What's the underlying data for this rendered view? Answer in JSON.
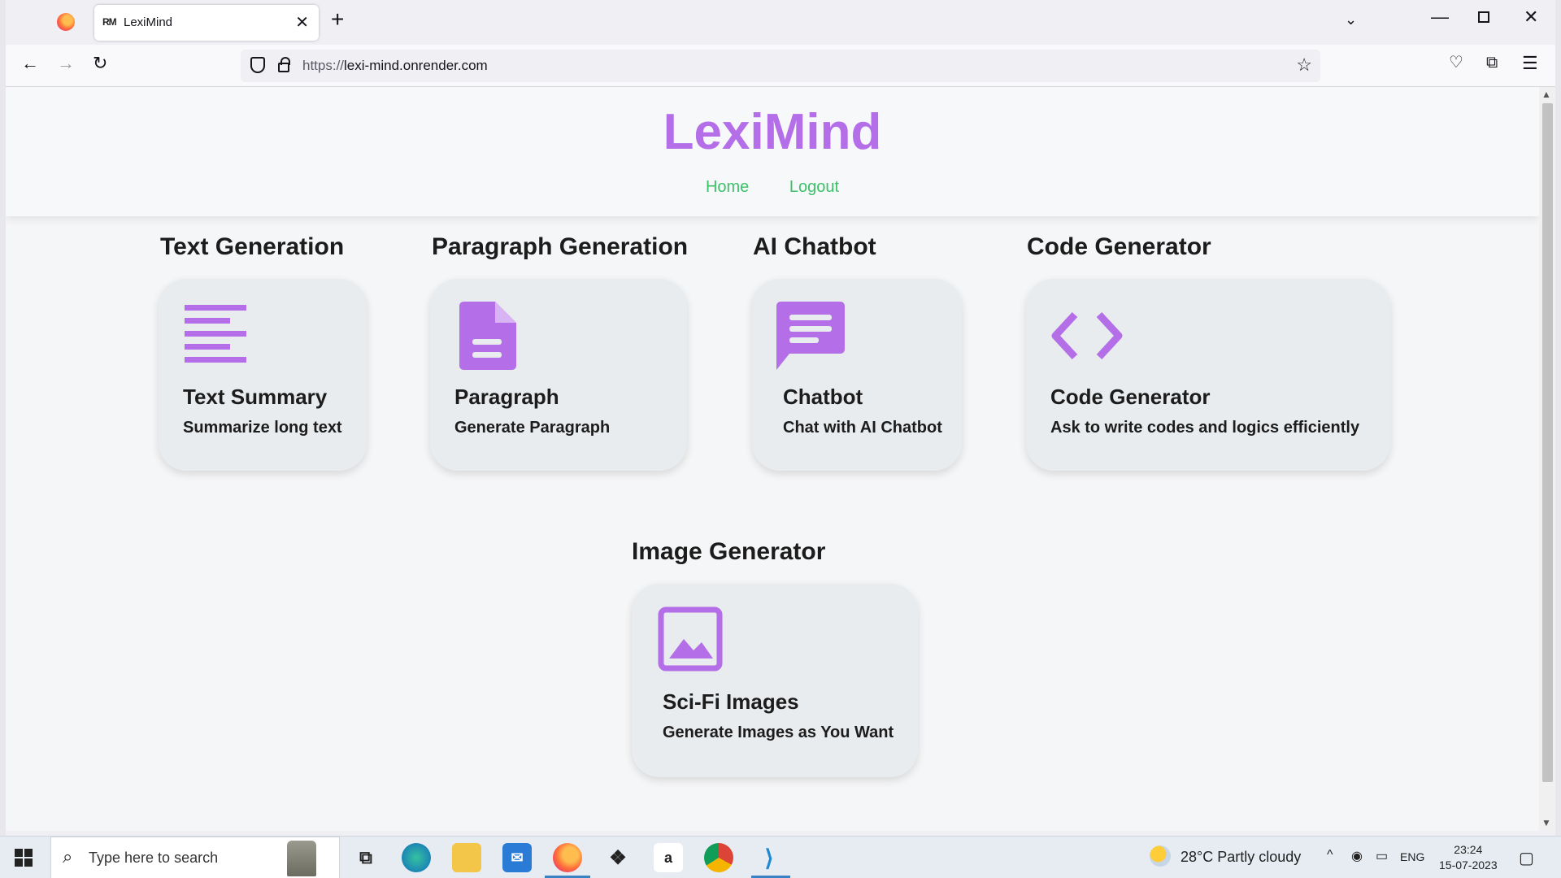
{
  "browser": {
    "tab_title": "LexiMind",
    "tab_favicon": "RM",
    "url_protocol": "https://",
    "url_host": "lexi-mind.onrender.com"
  },
  "site": {
    "title": "LexiMind",
    "nav": [
      "Home",
      "Logout"
    ],
    "brand_color": "#b36ee8",
    "nav_color": "#3cc16a"
  },
  "sections": [
    {
      "heading": "Text Generation",
      "card_title": "Text Summary",
      "card_desc": "Summarize long text",
      "icon": "text-lines-icon"
    },
    {
      "heading": "Paragraph Generation",
      "card_title": "Paragraph",
      "card_desc": "Generate Paragraph",
      "icon": "document-icon"
    },
    {
      "heading": "AI Chatbot",
      "card_title": "Chatbot",
      "card_desc": "Chat with AI Chatbot",
      "icon": "chat-bubble-icon"
    },
    {
      "heading": "Code Generator",
      "card_title": "Code Generator",
      "card_desc": "Ask to write codes and logics efficiently",
      "icon": "code-icon"
    },
    {
      "heading": "Image Generator",
      "card_title": "Sci-Fi Images",
      "card_desc": "Generate Images as You Want",
      "icon": "image-icon"
    }
  ],
  "taskbar": {
    "search_placeholder": "Type here to search",
    "weather": "28°C  Partly cloudy",
    "language": "ENG",
    "time": "23:24",
    "date": "15-07-2023"
  }
}
